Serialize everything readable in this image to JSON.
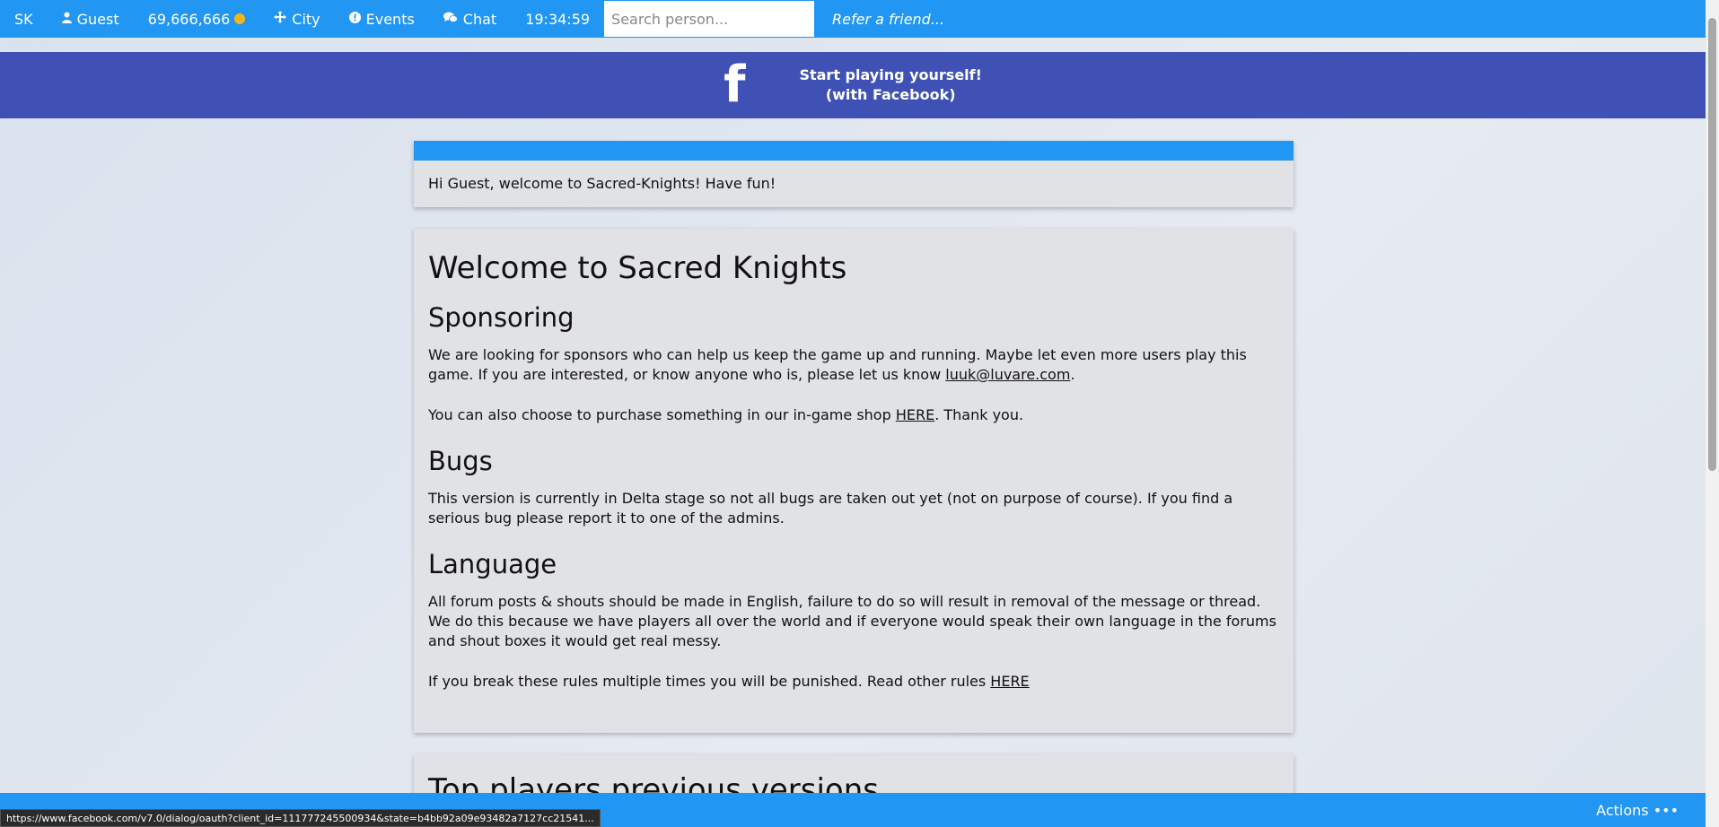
{
  "nav": {
    "brand": "SK",
    "user_label": "Guest",
    "coins": "69,666,666",
    "city_label": "City",
    "events_label": "Events",
    "chat_label": "Chat",
    "time": "19:34:59",
    "search_placeholder": "Search person...",
    "refer_label": "Refer a friend..."
  },
  "fb_banner": {
    "logo": "f",
    "line1": "Start playing yourself!",
    "line2": "(with Facebook)"
  },
  "welcome": {
    "message": "Hi Guest, welcome to Sacred-Knights! Have fun!"
  },
  "main": {
    "title": "Welcome to Sacred Knights",
    "sponsoring": {
      "heading": "Sponsoring",
      "p1_text": "We are looking for sponsors who can help us keep the game up and running. Maybe let even more users play this game. If you are interested, or know anyone who is, please let us know ",
      "p1_link": "luuk@luvare.com",
      "p1_end": ".",
      "p2_text": "You can also choose to purchase something in our in-game shop ",
      "p2_link": "HERE",
      "p2_end": ". Thank you."
    },
    "bugs": {
      "heading": "Bugs",
      "text": "This version is currently in Delta stage so not all bugs are taken out yet (not on purpose of course). If you find a serious bug please report it to one of the admins."
    },
    "language": {
      "heading": "Language",
      "p1": "All forum posts & shouts should be made in English, failure to do so will result in removal of the message or thread. We do this because we have players all over the world and if everyone would speak their own language in the forums and shout boxes it would get real messy.",
      "p2_text": "If you break these rules multiple times you will be punished. Read other rules ",
      "p2_link": "HERE"
    }
  },
  "top_players": {
    "title": "Top players previous versions"
  },
  "bottom": {
    "actions_label": "Actions •••",
    "status_url": "https://www.facebook.com/v7.0/dialog/oauth?client_id=111777245500934&state=b4bb92a09e93482a7127cc21541..."
  },
  "colors": {
    "nav_blue": "#2196f3",
    "facebook_indigo": "#3f51b5",
    "coin_gold": "#f7b519",
    "card_bg": "#e1e2e6"
  },
  "icons": {
    "user": "user-icon",
    "coin": "coin-icon",
    "city": "move-arrows-icon",
    "events": "exclamation-circle-icon",
    "chat": "chat-bubbles-icon",
    "facebook": "facebook-logo-icon"
  }
}
